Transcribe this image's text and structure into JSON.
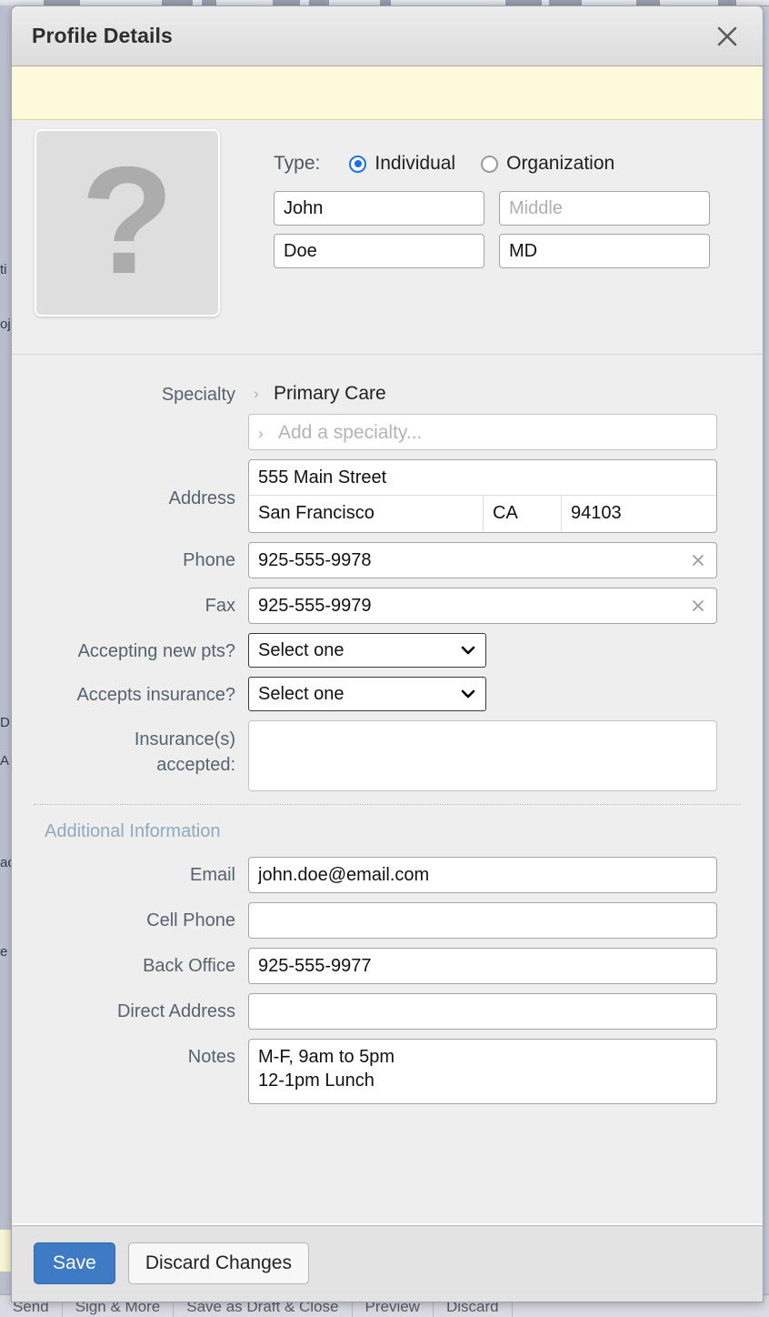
{
  "modal": {
    "title": "Profile Details",
    "close_icon": "close-icon"
  },
  "identity": {
    "avatar_glyph": "?",
    "type_label": "Type:",
    "options": [
      {
        "label": "Individual",
        "selected": true
      },
      {
        "label": "Organization",
        "selected": false
      }
    ],
    "first_name": "John",
    "middle_placeholder": "Middle",
    "last_name": "Doe",
    "suffix": "MD"
  },
  "details": {
    "specialty_label": "Specialty",
    "specialty_current": "Primary Care",
    "specialty_add_placeholder": "Add a specialty...",
    "address_label": "Address",
    "address_street": "555 Main Street",
    "address_city": "San Francisco",
    "address_state": "CA",
    "address_zip": "94103",
    "phone_label": "Phone",
    "phone_value": "925-555-9978",
    "fax_label": "Fax",
    "fax_value": "925-555-9979",
    "accepting_label": "Accepting new pts?",
    "accepting_value": "Select one",
    "insurance_q_label": "Accepts insurance?",
    "insurance_q_value": "Select one",
    "insurance_list_label_l1": "Insurance(s)",
    "insurance_list_label_l2": "accepted:",
    "insurance_list_value": ""
  },
  "additional": {
    "heading": "Additional Information",
    "email_label": "Email",
    "email_value": "john.doe@email.com",
    "cell_label": "Cell Phone",
    "cell_value": "",
    "back_office_label": "Back Office",
    "back_office_value": "925-555-9977",
    "direct_label": "Direct Address",
    "direct_value": "",
    "notes_label": "Notes",
    "notes_line1": "M-F, 9am to 5pm",
    "notes_line2": "12-1pm Lunch"
  },
  "footer": {
    "save_label": "Save",
    "discard_label": "Discard Changes"
  },
  "background": {
    "bottom_items": [
      "Send",
      "Sign & More",
      "Save as Draft & Close",
      "Preview",
      "Discard"
    ],
    "left_fragments": [
      "ti",
      "oj",
      "D",
      "A",
      "ac",
      "e"
    ]
  },
  "colors": {
    "accent_blue": "#1a73e8",
    "save_blue": "#3f7bc4",
    "notice_yellow": "#fcfadb",
    "heading_blue_gray": "#8fa9bd"
  }
}
